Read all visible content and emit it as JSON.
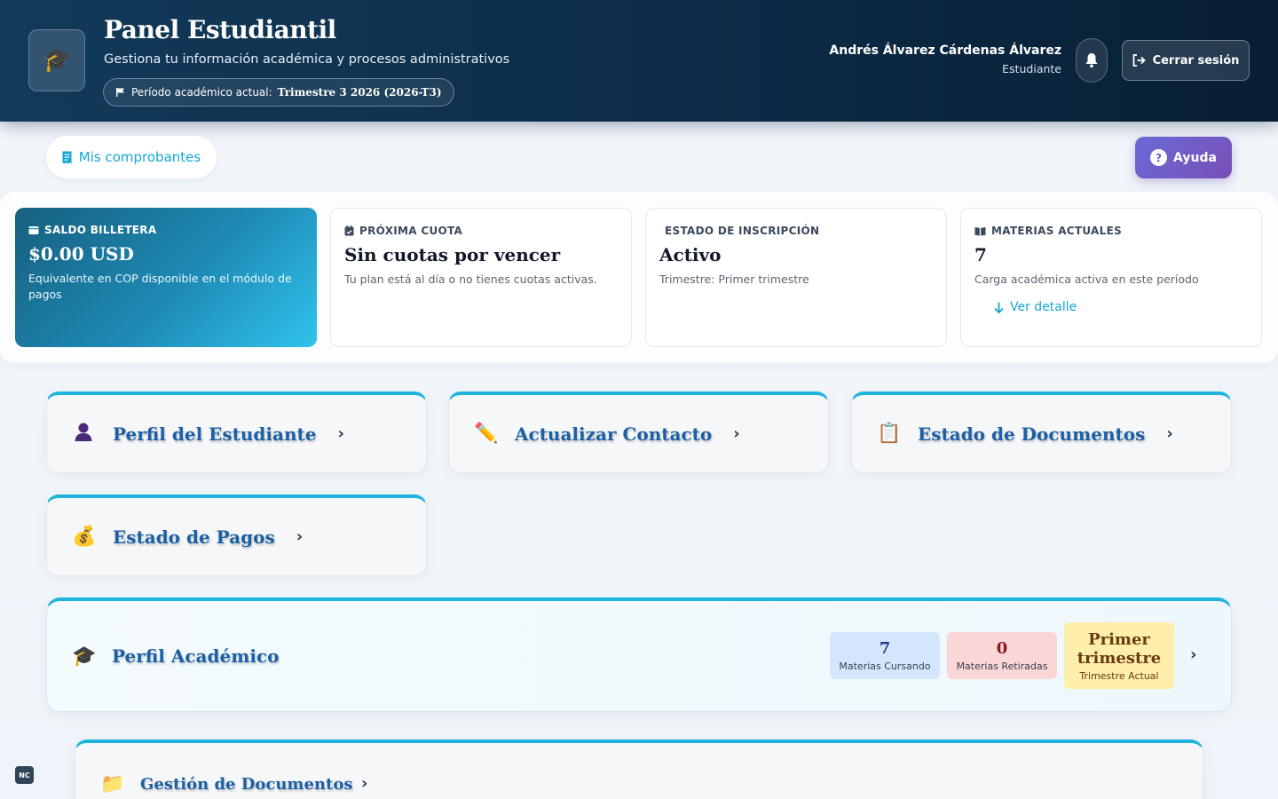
{
  "header": {
    "logo_icon": "graduation-cap-icon",
    "title": "Panel Estudiantil",
    "subtitle": "Gestiona tu información académica y procesos administrativos",
    "period_label": "Período académico actual:",
    "period_value": "Trimestre 3 2026 (2026-T3)",
    "user_name": "Andrés Álvarez Cárdenas Álvarez",
    "user_role": "Estudiante",
    "logout_label": "Cerrar sesión"
  },
  "actions": {
    "receipts_label": "Mis comprobantes",
    "help_label": "Ayuda",
    "help_glyph": "?"
  },
  "summary": {
    "wallet": {
      "label": "SALDO BILLETERA",
      "value": "$0.00 USD",
      "desc": "Equivalente en COP disponible en el módulo de pagos"
    },
    "next_fee": {
      "label": "PRÓXIMA CUOTA",
      "value": "Sin cuotas por vencer",
      "desc": "Tu plan está al día o no tienes cuotas activas."
    },
    "enrollment": {
      "label": "ESTADO DE INSCRIPCIÓN",
      "value": "Activo",
      "desc": "Trimestre: Primer trimestre"
    },
    "subjects": {
      "label": "MATERIAS ACTUALES",
      "value": "7",
      "desc": "Carga académica activa en este período",
      "link": "Ver detalle"
    }
  },
  "modules": {
    "profile": "Perfil del Estudiante",
    "contact": "Actualizar Contacto",
    "documents": "Estado de Documentos",
    "payments": "Estado de Pagos",
    "academic": "Perfil Académico",
    "doc_management": "Gestión de Documentos"
  },
  "academic_stats": {
    "current_value": "7",
    "current_label": "Materias Cursando",
    "withdrawn_value": "0",
    "withdrawn_label": "Materias Retiradas",
    "term_value": "Primer trimestre",
    "term_label": "Trimestre Actual"
  },
  "badge": "NC",
  "colors": {
    "header_bg": "#0d2c47",
    "accent": "#1fb3de",
    "link": "#14a6d4",
    "module_title": "#1b5fa6",
    "help_bg": "#6a6ad8"
  }
}
